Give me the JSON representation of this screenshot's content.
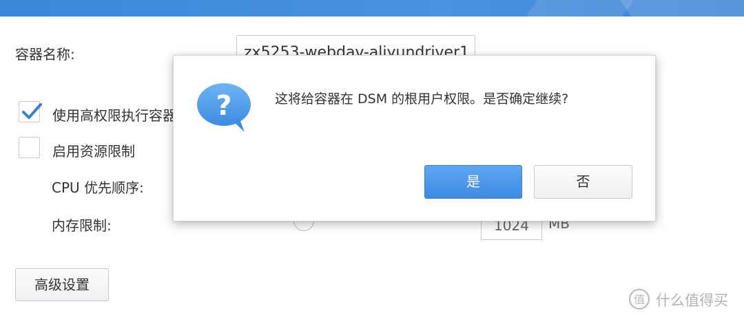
{
  "form": {
    "container_name_label": "容器名称:",
    "container_name_value": "zx5253-webdav-aliyundriver1",
    "privileged_checkbox_label": "使用高权限执行容器",
    "privileged_checked": true,
    "resource_limit_checkbox_label": "启用资源限制",
    "resource_limit_checked": false,
    "cpu_priority_label": "CPU 优先顺序:",
    "memory_limit_label": "内存限制:",
    "memory_value": "1024",
    "memory_unit": "MB",
    "advanced_settings_button": "高级设置"
  },
  "dialog": {
    "icon": "question-bubble-icon",
    "message": "这将给容器在 DSM 的根用户权限。是否确定继续?",
    "yes_button": "是",
    "no_button": "否"
  },
  "watermark": {
    "text": "什么值得买"
  },
  "colors": {
    "header_blue": "#3a86d9",
    "primary_button": "#4a93e8",
    "checkmark": "#3b7fd0"
  }
}
